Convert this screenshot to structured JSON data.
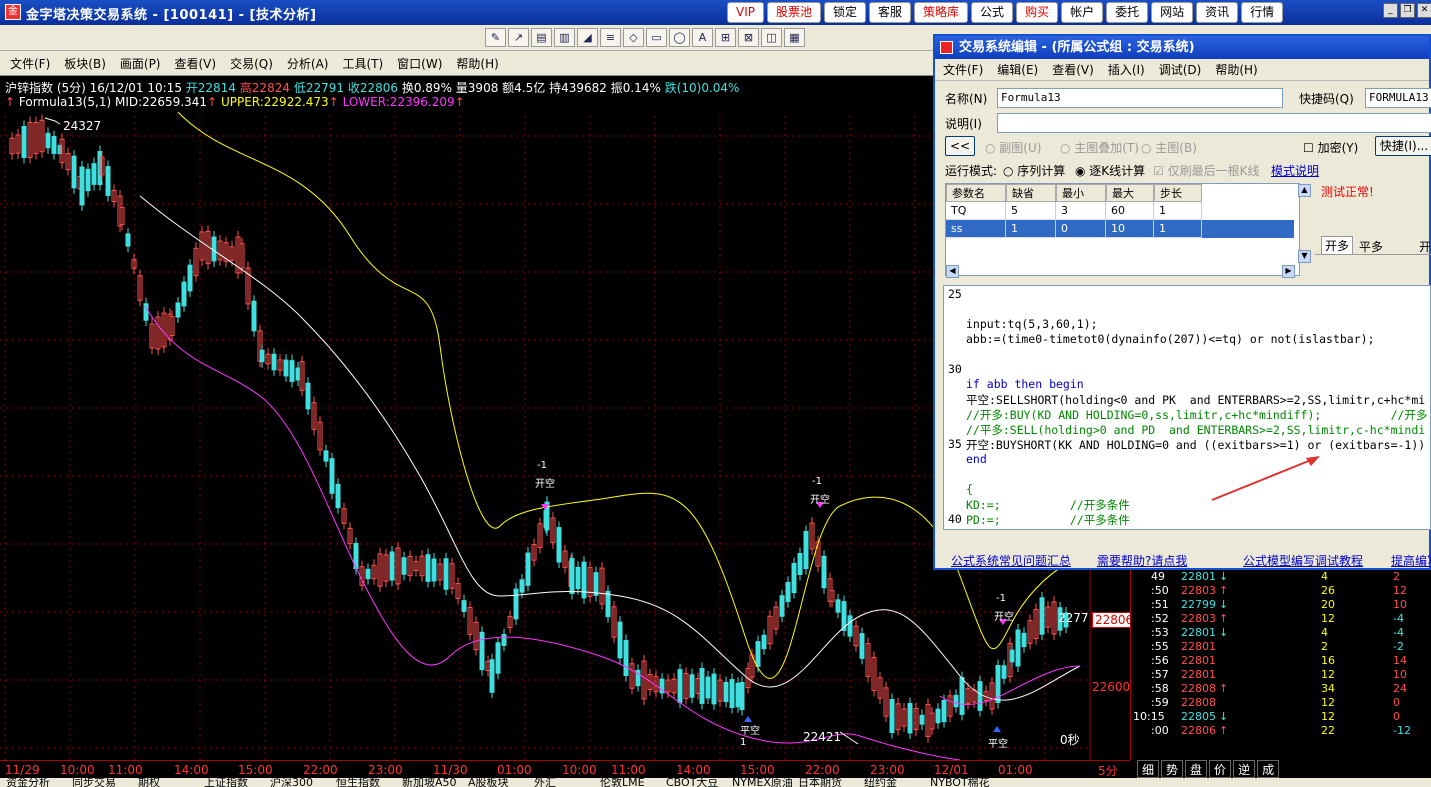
{
  "app": {
    "title": "金字塔决策交易系统 - [100141] - [技术分析]",
    "icon": "app-logo-icon"
  },
  "top_buttons": [
    {
      "label": "VIP",
      "red": true
    },
    {
      "label": "股票池",
      "red": true
    },
    {
      "label": "锁定",
      "red": false
    },
    {
      "label": "客服",
      "red": false
    },
    {
      "label": "策略库",
      "red": true
    },
    {
      "label": "公式",
      "red": false
    },
    {
      "label": "购买",
      "red": true
    },
    {
      "label": "帐户",
      "red": false
    },
    {
      "label": "委托",
      "red": false
    },
    {
      "label": "网站",
      "red": false
    },
    {
      "label": "资讯",
      "red": false
    },
    {
      "label": "行情",
      "red": false
    }
  ],
  "window_controls": [
    "_",
    "❐",
    "✕"
  ],
  "menu": [
    "文件(F)",
    "板块(B)",
    "画面(P)",
    "查看(V)",
    "交易(Q)",
    "分析(A)",
    "工具(T)",
    "窗口(W)",
    "帮助(H)"
  ],
  "toolbar_icons": [
    "✎",
    "↗",
    "▤",
    "▥",
    "◢",
    "≡",
    "◇",
    "▭",
    "◯",
    "A",
    "⊞",
    "⊠",
    "◫",
    "▦"
  ],
  "quote": {
    "name": "沪锌指数 (5分)",
    "date": "16/12/01 10:15",
    "open": "开22814",
    "high": "高22824",
    "low": "低22791",
    "close": "收22806",
    "turnover": "换0.89%",
    "volume": "量3908",
    "amount": "额4.5亿",
    "hold": "持439682",
    "amp": "振0.14%",
    "change": "跌(10)0.04%"
  },
  "indicator": {
    "name": "Formula13(5,1)",
    "mid": "MID:22659.341",
    "upper": "UPPER:22922.473",
    "lower": "LOWER:22396.209"
  },
  "chart_labels": {
    "high_mark": "24327",
    "low_mark": "22421",
    "price_tag": "22806",
    "axis_22600": "22600",
    "last_price": "2277",
    "seconds": "0秒",
    "period": "5分",
    "signals": [
      {
        "type": "开空",
        "num": "-1"
      },
      {
        "type": "开空",
        "num": "-1"
      },
      {
        "type": "开空",
        "num": "-1"
      },
      {
        "type": "平空",
        "num": "1"
      },
      {
        "type": "平空",
        "num": ""
      }
    ]
  },
  "x_axis": [
    "11/29",
    "10:00",
    "11:00",
    "14:00",
    "15:00",
    "22:00",
    "23:00",
    "11/30",
    "01:00",
    "10:00",
    "11:00",
    "14:00",
    "15:00",
    "22:00",
    "23:00",
    "12/01",
    "01:00"
  ],
  "trades": [
    {
      "t": "49",
      "p": "22801",
      "dir": "↓",
      "v": "4",
      "d": "2"
    },
    {
      "t": ":50",
      "p": "22803",
      "dir": "↑",
      "v": "26",
      "d": "12"
    },
    {
      "t": ":51",
      "p": "22799",
      "dir": "↓",
      "v": "20",
      "d": "10"
    },
    {
      "t": ":52",
      "p": "22803",
      "dir": "↑",
      "v": "12",
      "d": "-4"
    },
    {
      "t": ":53",
      "p": "22801",
      "dir": "↓",
      "v": "4",
      "d": "-4"
    },
    {
      "t": ":55",
      "p": "22801",
      "dir": "",
      "v": "2",
      "d": "-2"
    },
    {
      "t": ":56",
      "p": "22801",
      "dir": "",
      "v": "16",
      "d": "14"
    },
    {
      "t": ":57",
      "p": "22801",
      "dir": "",
      "v": "12",
      "d": "10"
    },
    {
      "t": ":58",
      "p": "22808",
      "dir": "↑",
      "v": "34",
      "d": "24"
    },
    {
      "t": ":59",
      "p": "22808",
      "dir": "",
      "v": "12",
      "d": "0"
    },
    {
      "t": "10:15",
      "p": "22805",
      "dir": "↓",
      "v": "12",
      "d": "0"
    },
    {
      "t": ":00",
      "p": "22806",
      "dir": "↑",
      "v": "22",
      "d": "-12"
    }
  ],
  "tabs": [
    "细",
    "势",
    "盘",
    "价",
    "逆",
    "成"
  ],
  "status": [
    "资金分析",
    "同步交易",
    "期权",
    "上证指数",
    "沪深300",
    "恒生指数",
    "新加坡A50",
    "A股板块",
    "外汇",
    "伦敦LME",
    "CBOT大豆",
    "NYMEX原油",
    "日本期货",
    "纽约金",
    "NYBOT棉花"
  ],
  "dialog": {
    "title": "交易系统编辑 - (所属公式组 : 交易系统)",
    "menu": [
      "文件(F)",
      "编辑(E)",
      "查看(V)",
      "插入(I)",
      "调试(D)",
      "帮助(H)"
    ],
    "name_label": "名称(N)",
    "name_value": "Formula13",
    "shortcut_label": "快捷码(Q)",
    "shortcut_value": "FORMULA13",
    "desc_label": "说明(I)",
    "desc_value": "",
    "collapse_btn": "<<",
    "radio_sub": "副图(U)",
    "radio_overlay": "主图叠加(T)",
    "radio_main": "主图(B)",
    "encrypt": "加密(Y)",
    "quick_btn": "快捷(I)...",
    "mode_label": "运行模式:",
    "mode_seq": "序列计算",
    "mode_bar": "逐K线计算",
    "mode_last": "仅刷最后一根K线",
    "mode_help": "模式说明",
    "test_status": "测试正常!",
    "param_headers": [
      "参数名",
      "缺省",
      "最小",
      "最大",
      "步长"
    ],
    "params": [
      [
        "TQ",
        "5",
        "3",
        "60",
        "1"
      ],
      [
        "ss",
        "1",
        "0",
        "10",
        "1"
      ]
    ],
    "side_tabs": [
      "开多",
      "平多",
      "开"
    ],
    "code_lines": [
      {
        "n": "25",
        "t": ""
      },
      {
        "n": "",
        "t": ""
      },
      {
        "n": "",
        "t": "input:tq(5,3,60,1);"
      },
      {
        "n": "",
        "t": "abb:=(time0-timetot0(dynainfo(207))<=tq) or not(islastbar);"
      },
      {
        "n": "",
        "t": ""
      },
      {
        "n": "30",
        "t": ""
      },
      {
        "n": "",
        "t": "if abb then begin"
      },
      {
        "n": "",
        "t": "平空:SELLSHORT(holding<0 and PK  and ENTERBARS>=2,SS,limitr,c+hc*mi"
      },
      {
        "n": "",
        "t": "//开多:BUY(KD AND HOLDING=0,ss,limitr,c+hc*mindiff);          //开多"
      },
      {
        "n": "",
        "t": "//平多:SELL(holding>0 and PD  and ENTERBARS>=2,SS,limitr,c-hc*mindi"
      },
      {
        "n": "35",
        "t": "开空:BUYSHORT(KK AND HOLDING=0 and ((exitbars>=1) or (exitbars=-1))"
      },
      {
        "n": "",
        "t": "end"
      },
      {
        "n": "",
        "t": ""
      },
      {
        "n": "",
        "t": "{"
      },
      {
        "n": "",
        "t": "KD:=;          //开多条件"
      },
      {
        "n": "40",
        "t": "PD:=;          //平多条件"
      }
    ],
    "links": [
      "公式系统常见问题汇总",
      "需要帮助?请点我",
      "公式模型编写调试教程",
      "提高编写"
    ]
  },
  "colors": {
    "up": "#ff5050",
    "down": "#40e0e0",
    "upper": "#ffff00",
    "mid": "#ffffff",
    "lower": "#ff33ff"
  }
}
